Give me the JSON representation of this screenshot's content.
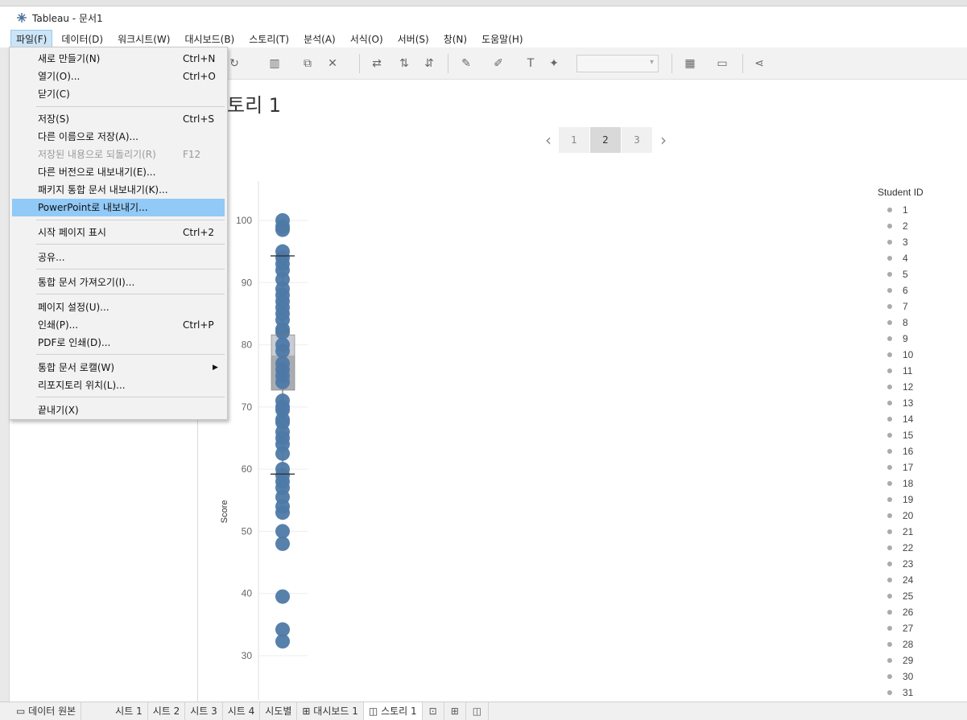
{
  "window": {
    "title": "Tableau - 문서1"
  },
  "menubar": [
    {
      "label": "파일(F)",
      "active": true
    },
    {
      "label": "데이터(D)"
    },
    {
      "label": "워크시트(W)"
    },
    {
      "label": "대시보드(B)"
    },
    {
      "label": "스토리(T)"
    },
    {
      "label": "분석(A)"
    },
    {
      "label": "서식(O)"
    },
    {
      "label": "서버(S)"
    },
    {
      "label": "창(N)"
    },
    {
      "label": "도움말(H)"
    }
  ],
  "file_menu": {
    "new": {
      "label": "새로 만들기(N)",
      "shortcut": "Ctrl+N"
    },
    "open": {
      "label": "열기(O)...",
      "shortcut": "Ctrl+O"
    },
    "close": {
      "label": "닫기(C)"
    },
    "save": {
      "label": "저장(S)",
      "shortcut": "Ctrl+S"
    },
    "save_as": {
      "label": "다른 이름으로 저장(A)..."
    },
    "revert": {
      "label": "저장된 내용으로 되돌리기(R)",
      "shortcut": "F12",
      "disabled": true
    },
    "export_version": {
      "label": "다른 버전으로 내보내기(E)..."
    },
    "export_packaged": {
      "label": "패키지 통합 문서 내보내기(K)..."
    },
    "export_ppt": {
      "label": "PowerPoint로 내보내기...",
      "highlighted": true
    },
    "start_page": {
      "label": "시작 페이지 표시",
      "shortcut": "Ctrl+2"
    },
    "share": {
      "label": "공유..."
    },
    "import_workbook": {
      "label": "통합 문서 가져오기(I)..."
    },
    "page_setup": {
      "label": "페이지 설정(U)..."
    },
    "print": {
      "label": "인쇄(P)...",
      "shortcut": "Ctrl+P"
    },
    "print_pdf": {
      "label": "PDF로 인쇄(D)..."
    },
    "workbook_locale": {
      "label": "통합 문서 로캘(W)"
    },
    "repository": {
      "label": "리포지토리 위치(L)..."
    },
    "exit": {
      "label": "끝내기(X)"
    }
  },
  "story": {
    "title": "토리 1",
    "pages": [
      "1",
      "2",
      "3"
    ],
    "current_page": "2"
  },
  "chart_data": {
    "type": "scatter",
    "title": "",
    "ylabel": "Score",
    "xlabel": "",
    "ylim": [
      27,
      102
    ],
    "yticks": [
      "30",
      "40",
      "50",
      "60",
      "70",
      "80",
      "90",
      "100"
    ],
    "y": [
      100,
      99,
      98.5,
      95,
      94,
      93,
      92,
      90.5,
      89,
      88,
      87,
      86,
      85,
      84,
      82.5,
      82,
      80,
      79,
      77,
      76,
      75,
      74,
      71,
      70,
      69.5,
      68,
      67.5,
      66,
      65,
      64,
      62.5,
      60,
      59,
      58,
      57,
      55.5,
      54,
      53,
      50,
      48,
      39.5,
      34.2,
      32.3
    ],
    "boxplot": {
      "whisker_low": 59.2,
      "q1": 72.7,
      "median": 78.3,
      "q3": 81.6,
      "whisker_high": 94.3
    },
    "color": "#4e79a7",
    "legend": {
      "title": "Student ID",
      "position": "right",
      "items": [
        "1",
        "2",
        "3",
        "4",
        "5",
        "6",
        "7",
        "8",
        "9",
        "10",
        "11",
        "12",
        "13",
        "14",
        "15",
        "16",
        "17",
        "18",
        "19",
        "20",
        "21",
        "22",
        "23",
        "24",
        "25",
        "26",
        "27",
        "28",
        "29",
        "30",
        "31"
      ]
    }
  },
  "bottom_tabs": {
    "datasource": "데이터 원본",
    "sheets": [
      "시트 1",
      "시트 2",
      "시트 3",
      "시트 4",
      "시도별"
    ],
    "dashboard": "대시보드 1",
    "story": "스토리 1"
  }
}
